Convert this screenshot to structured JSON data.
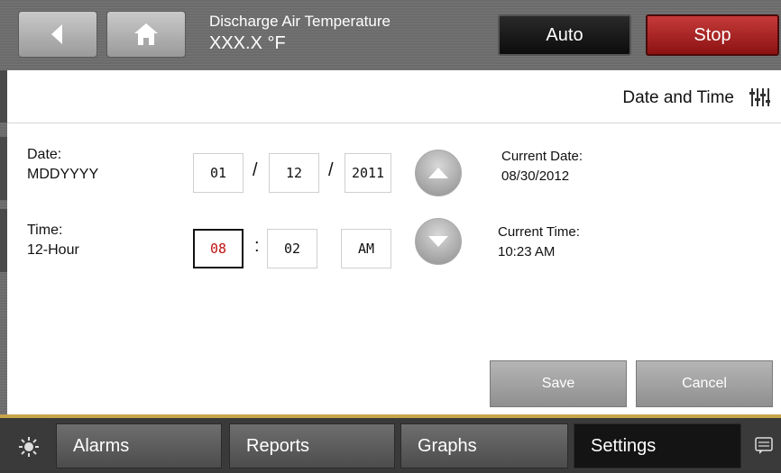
{
  "header": {
    "title_line1": "Discharge Air Temperature",
    "title_line2": "XXX.X °F",
    "auto_label": "Auto",
    "stop_label": "Stop"
  },
  "page": {
    "title": "Date and Time"
  },
  "date": {
    "label": "Date:",
    "format": "MDDYYYY",
    "month": "01",
    "day": "12",
    "year": "2011",
    "separator": "/",
    "current_label": "Current Date:",
    "current_value": "08/30/2012"
  },
  "time": {
    "label": "Time:",
    "format": "12-Hour",
    "hour": "08",
    "minute": "02",
    "ampm": "AM",
    "separator": ":",
    "current_label": "Current Time:",
    "current_value": "10:23 AM"
  },
  "actions": {
    "save_label": "Save",
    "cancel_label": "Cancel"
  },
  "nav": {
    "tabs": [
      "Alarms",
      "Reports",
      "Graphs",
      "Settings"
    ],
    "selected": "Settings"
  },
  "colors": {
    "stop": "#b22222",
    "active_digit": "#c01010",
    "accent_line": "#c8a44a"
  },
  "icons": [
    "back-arrow-icon",
    "home-icon",
    "sliders-icon",
    "up-arrow-icon",
    "down-arrow-icon",
    "sun-icon",
    "message-icon"
  ]
}
